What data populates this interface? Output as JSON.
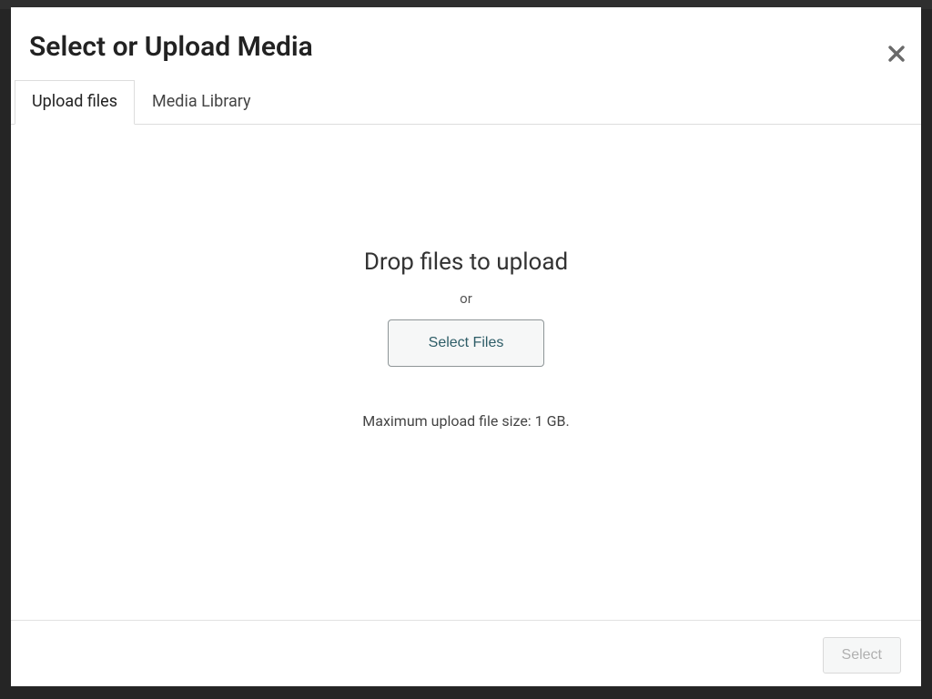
{
  "modal": {
    "title": "Select or Upload Media",
    "tabs": [
      {
        "label": "Upload files",
        "active": true
      },
      {
        "label": "Media Library",
        "active": false
      }
    ],
    "upload": {
      "drop_heading": "Drop files to upload",
      "or_text": "or",
      "select_files_label": "Select Files",
      "max_size_text": "Maximum upload file size: 1 GB."
    },
    "footer": {
      "select_label": "Select"
    }
  }
}
